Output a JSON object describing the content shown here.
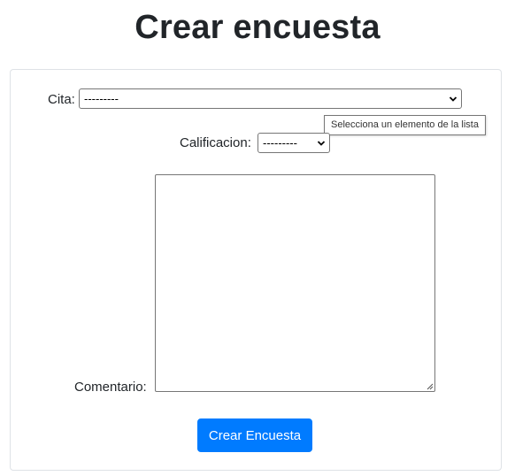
{
  "page": {
    "title": "Crear encuesta"
  },
  "form": {
    "cita": {
      "label": "Cita:",
      "selected": "---------"
    },
    "tooltip": "Selecciona un elemento de la lista",
    "calificacion": {
      "label": "Calificacion:",
      "selected": "---------"
    },
    "comentario": {
      "label": "Comentario:",
      "value": ""
    },
    "submit_label": "Crear Encuesta"
  },
  "colors": {
    "primary": "#007bff",
    "text": "#212529",
    "border": "#dee2e6"
  },
  "icons": {
    "select_arrow": "chevron-down-icon",
    "textarea_resize": "resize-grip-icon"
  }
}
